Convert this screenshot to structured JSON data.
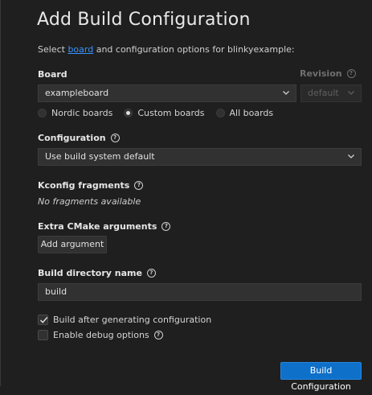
{
  "title": "Add Build Configuration",
  "subtitle": {
    "prefix": "Select ",
    "link": "board",
    "suffix": " and configuration options for blinkyexample:"
  },
  "board": {
    "label": "Board",
    "value": "exampleboard",
    "revision_label": "Revision",
    "revision_value": "default",
    "filters": [
      {
        "label": "Nordic boards",
        "selected": false
      },
      {
        "label": "Custom boards",
        "selected": true
      },
      {
        "label": "All boards",
        "selected": false
      }
    ]
  },
  "configuration": {
    "label": "Configuration",
    "value": "Use build system default"
  },
  "kconfig": {
    "label": "Kconfig fragments",
    "empty_text": "No fragments available"
  },
  "cmake": {
    "label": "Extra CMake arguments",
    "add_button": "Add argument"
  },
  "build_dir": {
    "label": "Build directory name",
    "value": "build"
  },
  "options": {
    "build_after": {
      "label": "Build after generating configuration",
      "checked": true
    },
    "debug": {
      "label": "Enable debug options",
      "checked": false
    }
  },
  "submit_label": "Build Configuration",
  "colors": {
    "accent": "#0e70c9",
    "link": "#3794ff",
    "background": "#1f1f1f"
  }
}
